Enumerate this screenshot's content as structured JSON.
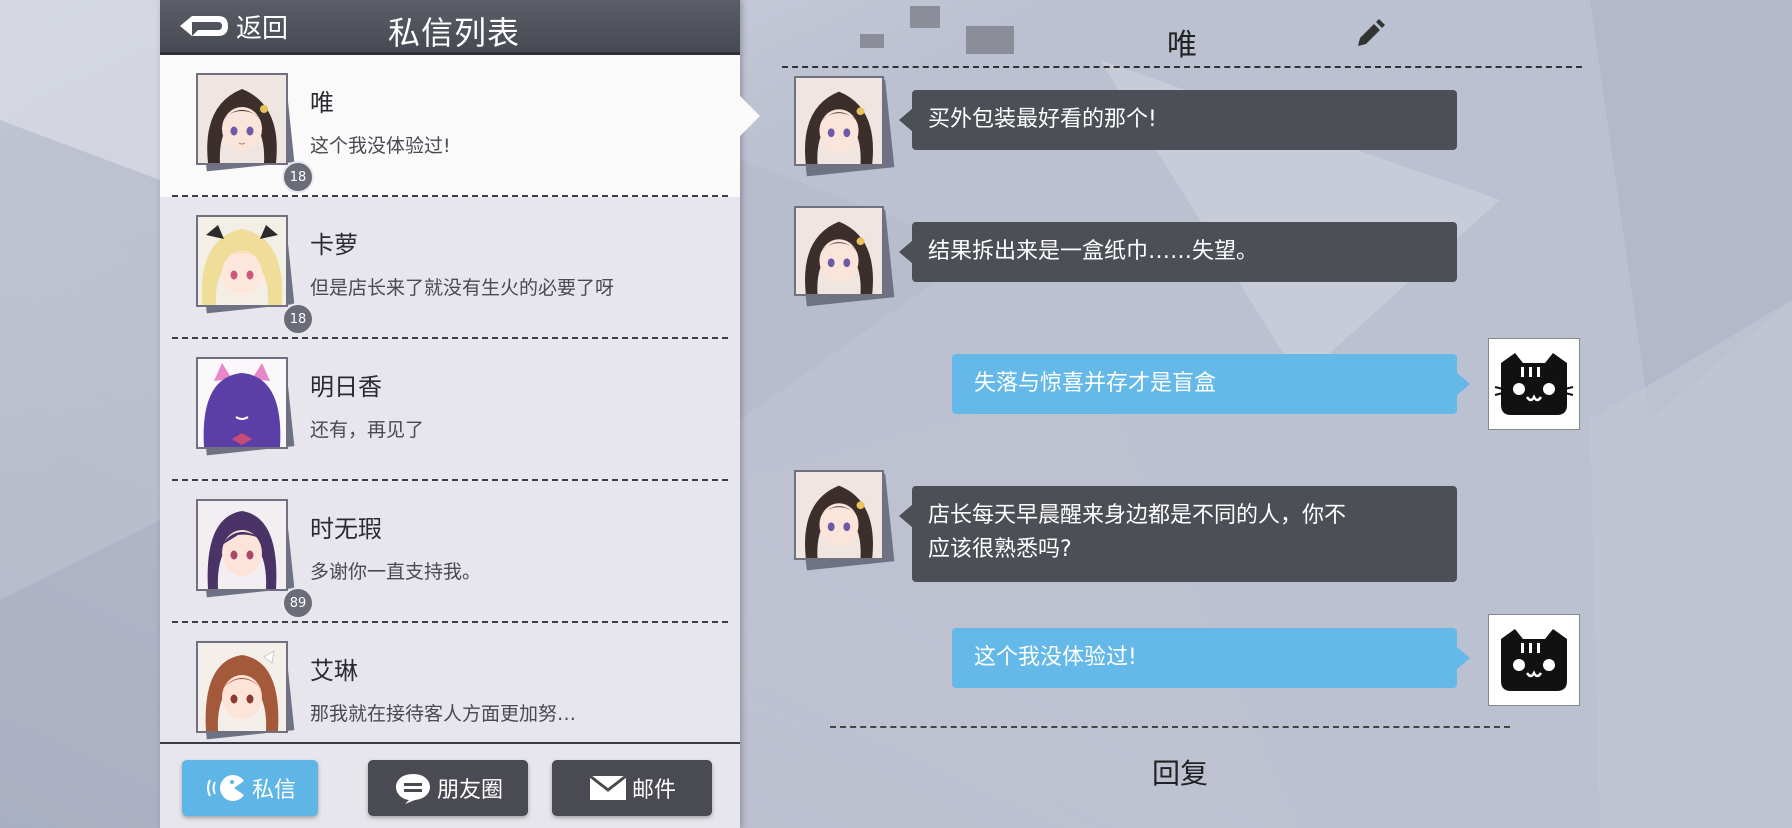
{
  "header": {
    "back_label": "返回",
    "title": "私信列表"
  },
  "contacts": [
    {
      "name": "唯",
      "preview": "这个我没体验过!",
      "level": "18",
      "active": true,
      "avatar": "girl-dark-hair"
    },
    {
      "name": "卡萝",
      "preview": "但是店长来了就没有生火的必要了呀",
      "level": "18",
      "active": false,
      "avatar": "girl-blonde"
    },
    {
      "name": "明日香",
      "preview": "还有，再见了",
      "level": "",
      "active": false,
      "avatar": "girl-purple-cat-ears"
    },
    {
      "name": "时无瑕",
      "preview": "多谢你一直支持我。",
      "level": "89",
      "active": false,
      "avatar": "girl-long-purple-hair"
    },
    {
      "name": "艾琳",
      "preview": "那我就在接待客人方面更加努…",
      "level": "",
      "active": false,
      "avatar": "girl-brown-hair"
    }
  ],
  "tabs": [
    {
      "label": "私信",
      "icon": "pacman-chat-icon",
      "active": true
    },
    {
      "label": "朋友圈",
      "icon": "speech-bubble-icon",
      "active": false
    },
    {
      "label": "邮件",
      "icon": "mail-icon",
      "active": false
    }
  ],
  "chat": {
    "title": "唯",
    "messages": [
      {
        "from": "contact",
        "text": "买外包装最好看的那个!"
      },
      {
        "from": "contact",
        "text": "结果拆出来是一盒纸巾……失望。"
      },
      {
        "from": "self",
        "text": "失落与惊喜并存才是盲盒"
      },
      {
        "from": "contact",
        "text_line1": "店长每天早晨醒来身边都是不同的人，你不",
        "text_line2": "应该很熟悉吗?"
      },
      {
        "from": "self",
        "text": "这个我没体验过!"
      }
    ],
    "reply_label": "回复"
  },
  "colors": {
    "accent": "#5fb5e6",
    "bubble_in": "#4d4f56",
    "bubble_out": "#64b9e8",
    "header_bg": "#4e5159"
  }
}
